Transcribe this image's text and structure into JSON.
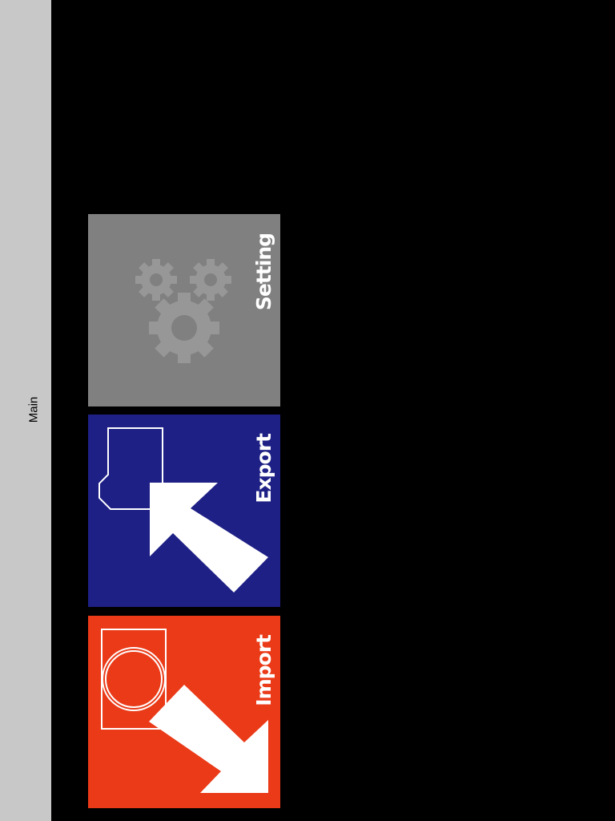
{
  "sidebar": {
    "label": "Main"
  },
  "tiles": [
    {
      "label": "Setting",
      "color": "#808080",
      "icon": "gears-icon"
    },
    {
      "label": "Export",
      "color": "#1e2085",
      "icon": "export-arrow-icon"
    },
    {
      "label": "Import",
      "color": "#ea3a18",
      "icon": "import-arrow-icon"
    }
  ],
  "colors": {
    "background": "#000000",
    "sidebar": "#c8c8c8",
    "icon_gray": "#9a9a9a",
    "white": "#ffffff"
  }
}
